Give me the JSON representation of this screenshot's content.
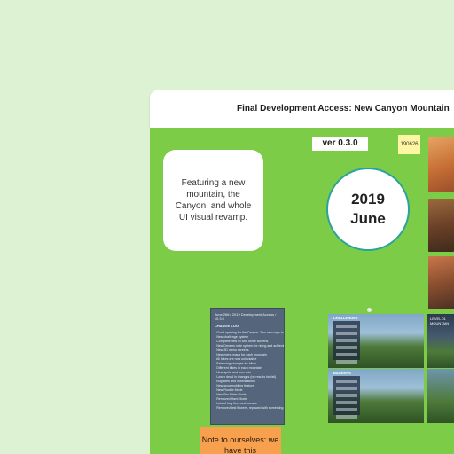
{
  "frame": {
    "title": "Final Development Access: New Canyon Mountain"
  },
  "board": {
    "version": "ver 0.3.0",
    "sticky_small": "190626",
    "feature_card": "Featuring a new mountain, the Canyon, and whole UI visual revamp.",
    "date": {
      "year": "2019",
      "month": "June"
    },
    "changelog": {
      "title": "June 26th, 2019 Development Access / v0.3.0",
      "heading": "CHANGE LOG",
      "lines": [
        "- Good opening for the Canyon. Two new rope-in routes",
        "- New challenge system",
        "- Complete new UI and home screens",
        "- New Dreams note system for riding and achieving",
        "- New 3D menu screens",
        "- New menu maps for each mountain",
        "- All bikes are now unlockable",
        "- Balancing changes for bikes",
        "- Different bikes in each mountain",
        "- New sprite and icon arts",
        "- Lower dead in changes (no results for fail)",
        "- Bug fixes and optimizations",
        "- New snowmobiling feature",
        "- New Rookie Mode",
        "- New Pro Rider Mode",
        "- Removed Hard Mode",
        "- Lots of bug fixes and tweaks",
        "- Removed test flowers, replaced with something"
      ]
    },
    "note": "Note to ourselves: we have this",
    "screenshots": [
      {
        "caption": "CHALLENGES"
      },
      {
        "caption": "BACKERS"
      }
    ],
    "side_captions": [
      "LEVEL 01 MOUNTAIN",
      ""
    ],
    "colors": {
      "board": "#7dcc48",
      "background": "#dcf2d3",
      "circle_border": "#2aa39a",
      "note": "#f7a14f",
      "sticky": "#fff6a3"
    }
  }
}
